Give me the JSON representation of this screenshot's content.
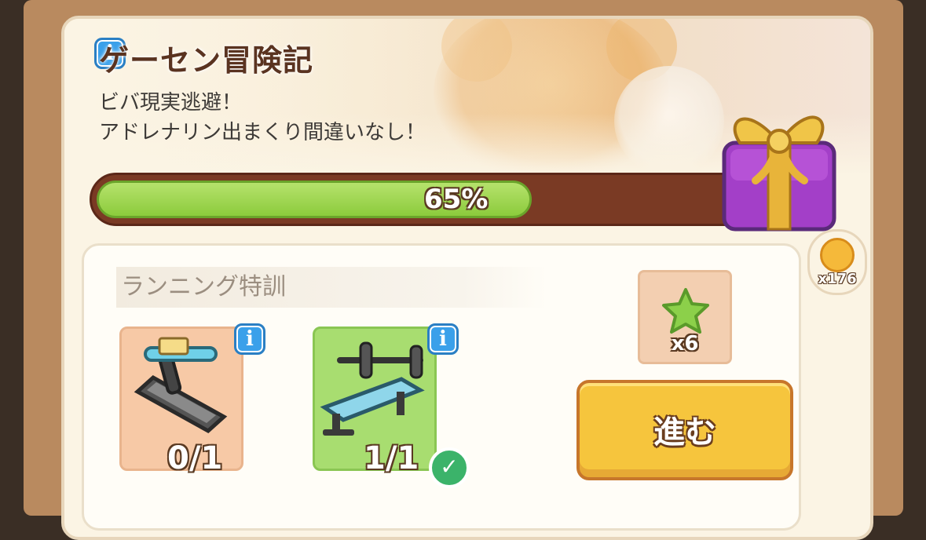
{
  "event": {
    "title": "ゲーセン冒険記",
    "description_line1": "ビバ現実逃避！",
    "description_line2": "アドレナリン出まくり間違いなし！",
    "progress_percent": 65,
    "progress_label": "65%"
  },
  "reward": {
    "coin_icon": "sun-coin-icon",
    "coin_count": "x176",
    "chest_icon": "gift-box-icon"
  },
  "task": {
    "title": "ランニング特訓",
    "items": [
      {
        "icon": "treadmill-icon",
        "count": "0/1",
        "complete": false
      },
      {
        "icon": "bench-press-icon",
        "count": "1/1",
        "complete": true
      }
    ],
    "reward_icon": "green-star-icon",
    "reward_count": "x6",
    "go_button_label": "進む"
  },
  "colors": {
    "progress_fill": "#8ccb3c",
    "progress_track": "#7a3a24",
    "button": "#f6c53d",
    "info": "#3aa0ea"
  }
}
